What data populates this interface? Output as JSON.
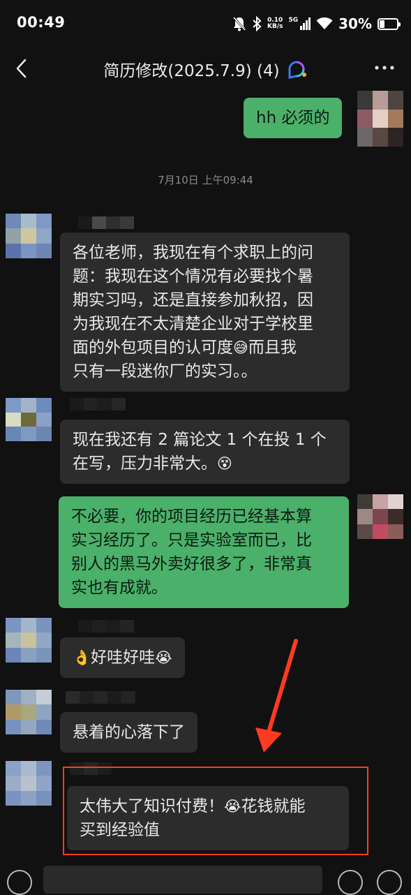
{
  "status_bar": {
    "time": "00:49",
    "net_speed_value": "0.10",
    "net_speed_unit": "KB/s",
    "signal_label": "5G",
    "battery_percent": "30%",
    "battery_level": 0.3,
    "icons": [
      "mute-icon",
      "bluetooth-icon",
      "signal-icon",
      "wifi-icon",
      "battery-icon"
    ]
  },
  "header": {
    "title": "简历修改(2025.7.9) (4)",
    "back_icon": "chevron-left-icon",
    "more_icon": "more-icon",
    "badge_icon": "group-chat-icon"
  },
  "messages": [
    {
      "side": "out",
      "text": "hh 必须的"
    },
    {
      "type": "timestamp",
      "text": "7月10日 上午09:44"
    },
    {
      "side": "in",
      "lines": [
        "各位老师，我现在有个求职上的问",
        "题：我现在这个情况有必要找个暑",
        "期实习吗，还是直接参加秋招，因",
        "为我现在不太清楚企业对于学校里"
      ],
      "line5_pre": "面的外包项目的认可度",
      "line5_emoji": "😅",
      "line5_post": "而且我",
      "line6": "只有一段迷你厂的实习。。"
    },
    {
      "side": "in",
      "lines": [
        "现在我还有 2 篇论文 1 个在投 1 个"
      ],
      "line2_pre": "在写，压力非常大。",
      "line2_emoji": "😵"
    },
    {
      "side": "out",
      "lines": [
        "不必要，你的项目经历已经基本算",
        "实习经历了。只是实验室而已，比",
        "别人的黑马外卖好很多了，非常真",
        "实也有成就。"
      ]
    },
    {
      "side": "in",
      "emoji_pre": "👌",
      "text": "好哇好哇",
      "emoji_post": "😭"
    },
    {
      "side": "in",
      "text": "悬着的心落下了"
    },
    {
      "side": "in",
      "line1_pre": "太伟大了知识付费！",
      "line1_emoji": "😭",
      "line1_post": "花钱就能",
      "line2": "买到经验值"
    }
  ],
  "annotation": {
    "highlight_color": "#ff3b1f"
  },
  "colors": {
    "background": "#111111",
    "incoming_bubble": "#2c2c2c",
    "outgoing_bubble": "#4bb06a"
  }
}
